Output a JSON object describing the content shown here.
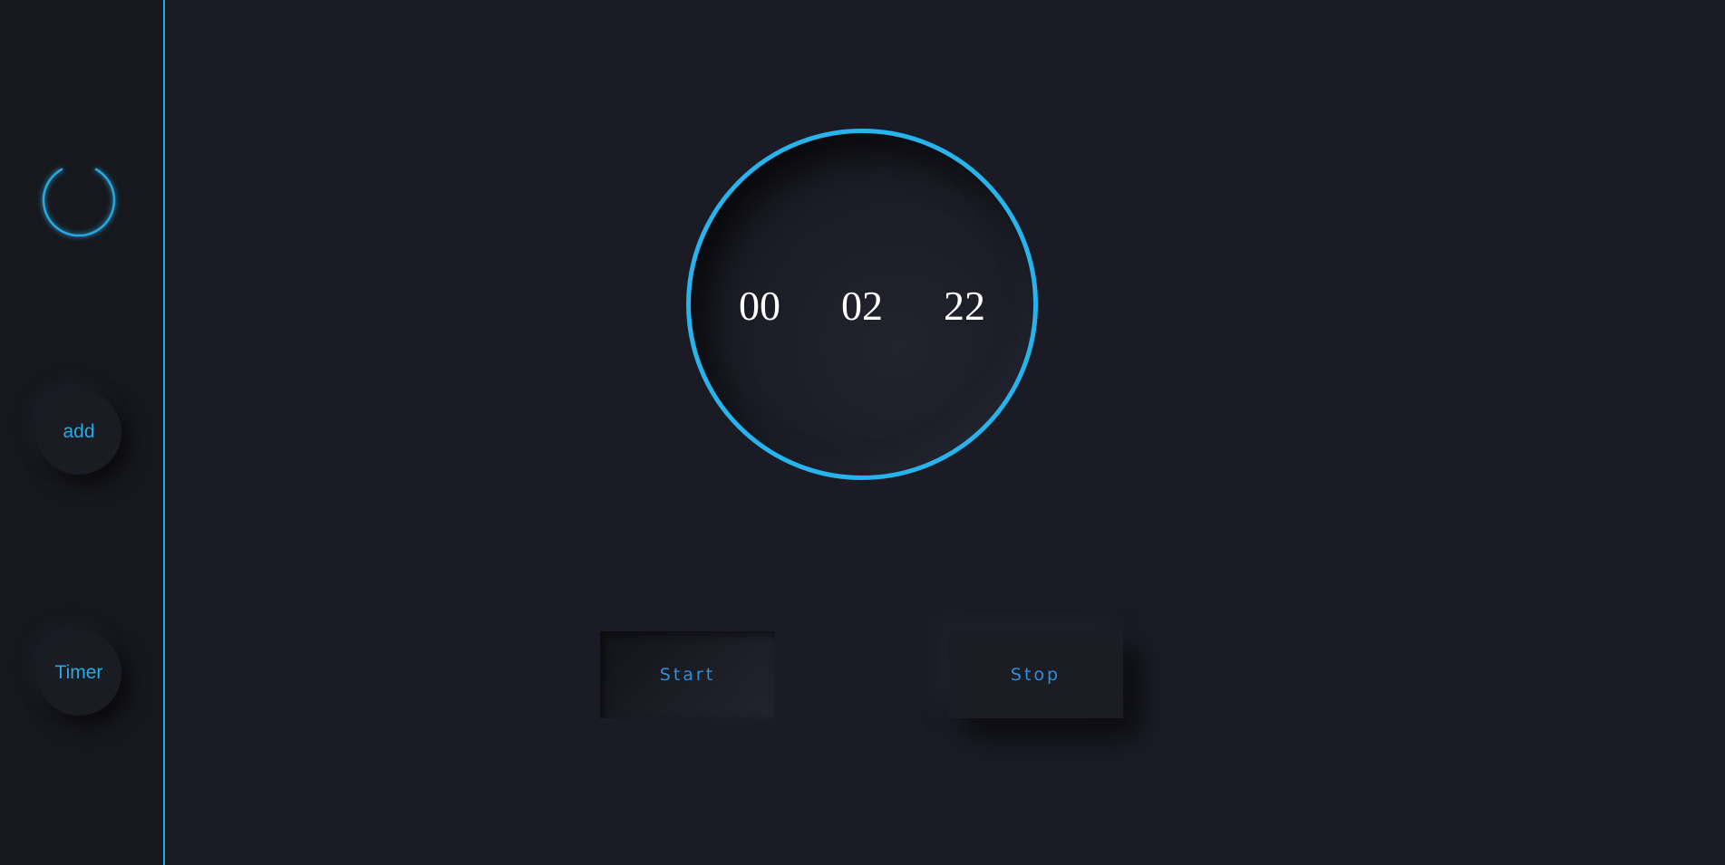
{
  "sidebar": {
    "power_icon": "power-icon",
    "add_label": "add",
    "timer_label": "Timer"
  },
  "clock": {
    "hours": "00",
    "minutes": "02",
    "seconds": "22"
  },
  "controls": {
    "start_label": "Start",
    "stop_label": "Stop"
  },
  "colors": {
    "accent": "#27a9e1",
    "background": "#1a1b24",
    "sidebar_bg": "#17181e",
    "digit_color": "#ffffff"
  }
}
